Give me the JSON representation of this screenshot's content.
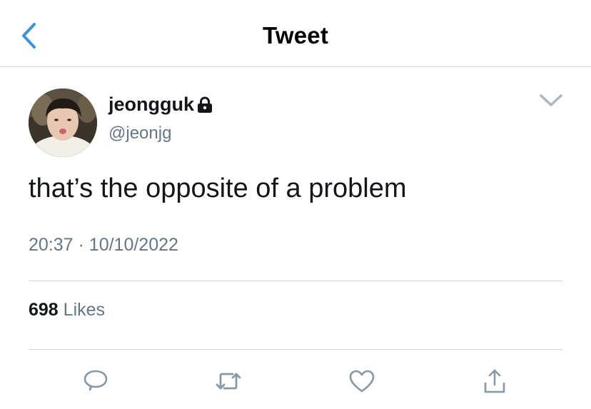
{
  "header": {
    "title": "Tweet",
    "back_icon": "chevron-left-icon",
    "accent_color": "#3b94d9"
  },
  "tweet": {
    "user": {
      "display_name": "jeongguk",
      "handle": "@jeonjg",
      "protected_icon": "lock-icon"
    },
    "text": "that’s the opposite of a problem",
    "time": "20:37",
    "separator": "·",
    "date": "10/10/2022",
    "likes_count": "698",
    "likes_label": "Likes",
    "more_icon": "chevron-down-icon"
  },
  "actions": [
    {
      "name": "reply",
      "icon": "comment-icon"
    },
    {
      "name": "retweet",
      "icon": "retweet-icon"
    },
    {
      "name": "like",
      "icon": "heart-icon"
    },
    {
      "name": "share",
      "icon": "share-icon"
    }
  ],
  "colors": {
    "text_primary": "#14171a",
    "text_secondary": "#657786",
    "divider": "#d6d6d6",
    "icon_gray": "#8899a6"
  }
}
